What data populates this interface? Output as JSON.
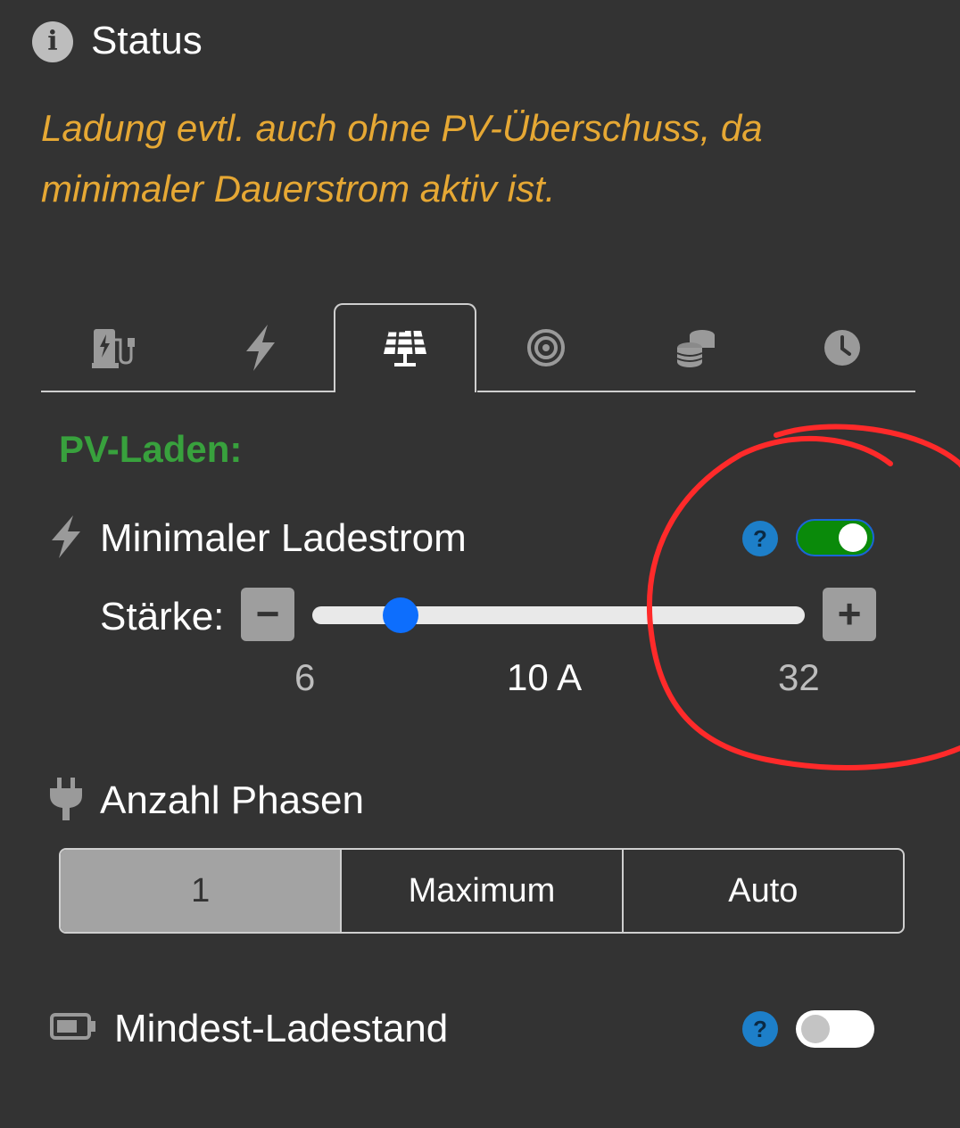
{
  "status": {
    "icon": "info-icon",
    "title": "Status",
    "message_line1": "Ladung evtl. auch ohne PV-Überschuss, da",
    "message_line2": "minimaler Dauerstrom aktiv ist."
  },
  "tabs": [
    {
      "icon": "ev-charger-icon",
      "active": false
    },
    {
      "icon": "bolt-icon",
      "active": false
    },
    {
      "icon": "solar-panel-icon",
      "active": true
    },
    {
      "icon": "target-icon",
      "active": false
    },
    {
      "icon": "coins-icon",
      "active": false
    },
    {
      "icon": "clock-icon",
      "active": false
    }
  ],
  "pv": {
    "title": "PV-Laden:",
    "min_current": {
      "icon": "bolt-icon",
      "label": "Minimaler Ladestrom",
      "help": "?",
      "enabled": true,
      "strength_label": "Stärke:",
      "minus": "−",
      "plus": "+",
      "min": "6",
      "max": "32",
      "value_text": "10 A",
      "value": 10
    },
    "phases": {
      "icon": "plug-icon",
      "label": "Anzahl Phasen",
      "options": [
        "1",
        "Maximum",
        "Auto"
      ],
      "selected": "1"
    },
    "min_soc": {
      "icon": "battery-icon",
      "label": "Mindest-Ladestand",
      "help": "?",
      "enabled": false
    }
  },
  "colors": {
    "background": "#333333",
    "warning_text": "#e6a834",
    "section_title": "#38a13d",
    "slider_thumb": "#0d6efd",
    "toggle_on": "#0a8a0a",
    "help_badge": "#1d7fc9",
    "annotation_circle": "#ff2a2a"
  }
}
